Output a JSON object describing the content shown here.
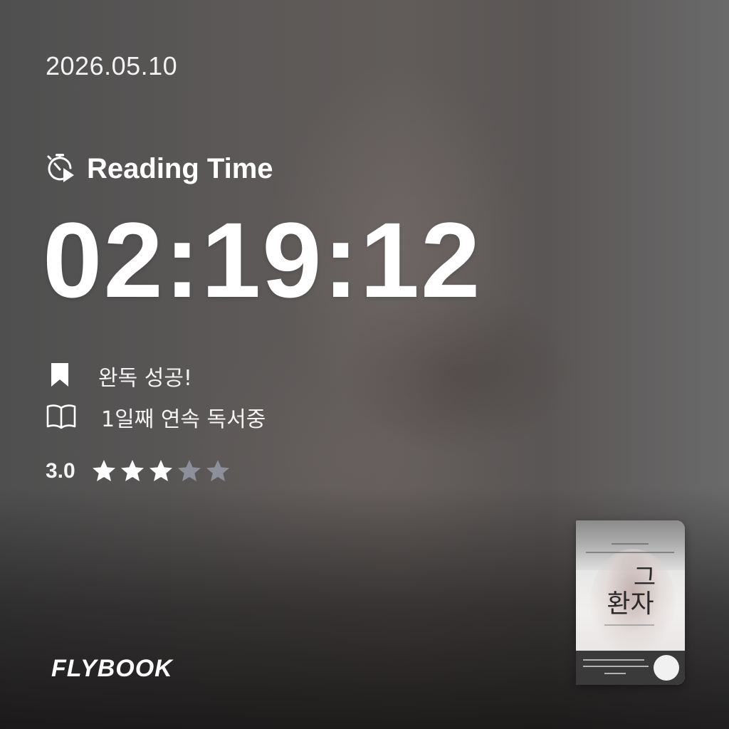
{
  "date": "2026.05.10",
  "reading": {
    "label": "Reading Time",
    "icon": "stopwatch-play-icon",
    "time": "02:19:12"
  },
  "status": {
    "complete": {
      "icon": "bookmark-icon",
      "text": "완독 성공!"
    },
    "streak": {
      "icon": "open-book-icon",
      "text": "1일째 연속 독서중"
    }
  },
  "rating": {
    "value_text": "3.0",
    "value": 3,
    "max": 5,
    "colors": {
      "filled": "#ffffff",
      "empty": "#8d8f9a"
    }
  },
  "brand": "FLYBOOK",
  "book": {
    "title_top": "그",
    "title_main": "환자"
  }
}
